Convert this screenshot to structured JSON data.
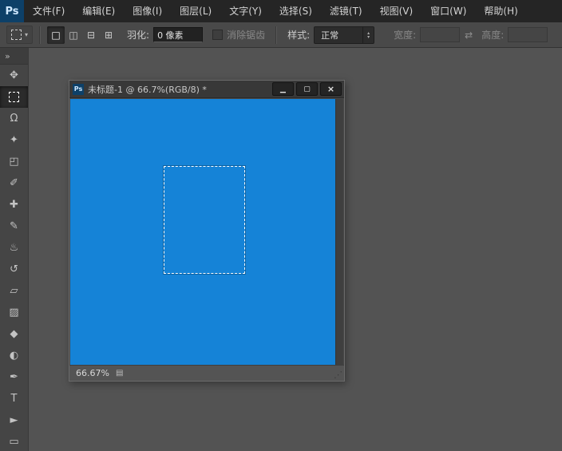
{
  "app": {
    "logo": "Ps",
    "logo_bg": "#0d4068"
  },
  "menu": {
    "items": [
      "文件(F)",
      "编辑(E)",
      "图像(I)",
      "图层(L)",
      "文字(Y)",
      "选择(S)",
      "滤镜(T)",
      "视图(V)",
      "窗口(W)",
      "帮助(H)"
    ]
  },
  "options": {
    "preset_arrow": "▾",
    "modes": [
      {
        "name": "new-selection",
        "glyph": "□"
      },
      {
        "name": "add-to-selection",
        "glyph": "◫"
      },
      {
        "name": "subtract-from-selection",
        "glyph": "⊟"
      },
      {
        "name": "intersect-with-selection",
        "glyph": "⊞"
      }
    ],
    "feather_label": "羽化:",
    "feather_value": "0 像素",
    "antialias_label": "消除锯齿",
    "style_label": "样式:",
    "style_value": "正常",
    "spin_up": "▴",
    "spin_down": "▾",
    "width_label": "宽度:",
    "swap_icon": "⇄",
    "height_label": "高度:"
  },
  "toolbar": {
    "expand_icon": "»",
    "tools": [
      {
        "name": "move",
        "glyph": "✥"
      },
      {
        "name": "rectangular-marquee",
        "glyph": ""
      },
      {
        "name": "lasso",
        "glyph": "Ω"
      },
      {
        "name": "quick-selection",
        "glyph": "✦"
      },
      {
        "name": "crop",
        "glyph": "◰"
      },
      {
        "name": "eyedropper",
        "glyph": "✐"
      },
      {
        "name": "healing-brush",
        "glyph": "✚"
      },
      {
        "name": "brush",
        "glyph": "✎"
      },
      {
        "name": "clone-stamp",
        "glyph": "♨"
      },
      {
        "name": "history-brush",
        "glyph": "↺"
      },
      {
        "name": "eraser",
        "glyph": "▱"
      },
      {
        "name": "gradient",
        "glyph": "▨"
      },
      {
        "name": "blur",
        "glyph": "◆"
      },
      {
        "name": "dodge",
        "glyph": "◐"
      },
      {
        "name": "pen",
        "glyph": "✒"
      },
      {
        "name": "type",
        "glyph": "T"
      },
      {
        "name": "path-selection",
        "glyph": "►"
      },
      {
        "name": "rectangle-shape",
        "glyph": "▭"
      }
    ]
  },
  "document": {
    "icon": "Ps",
    "title": "未标题-1 @ 66.7%(RGB/8) *",
    "minimize_icon": "▁",
    "maximize_icon": "▢",
    "close_icon": "×",
    "canvas_color": "#1583d7",
    "zoom": "66.67%",
    "status_icon": "▤",
    "grip_icon": "⋰"
  }
}
